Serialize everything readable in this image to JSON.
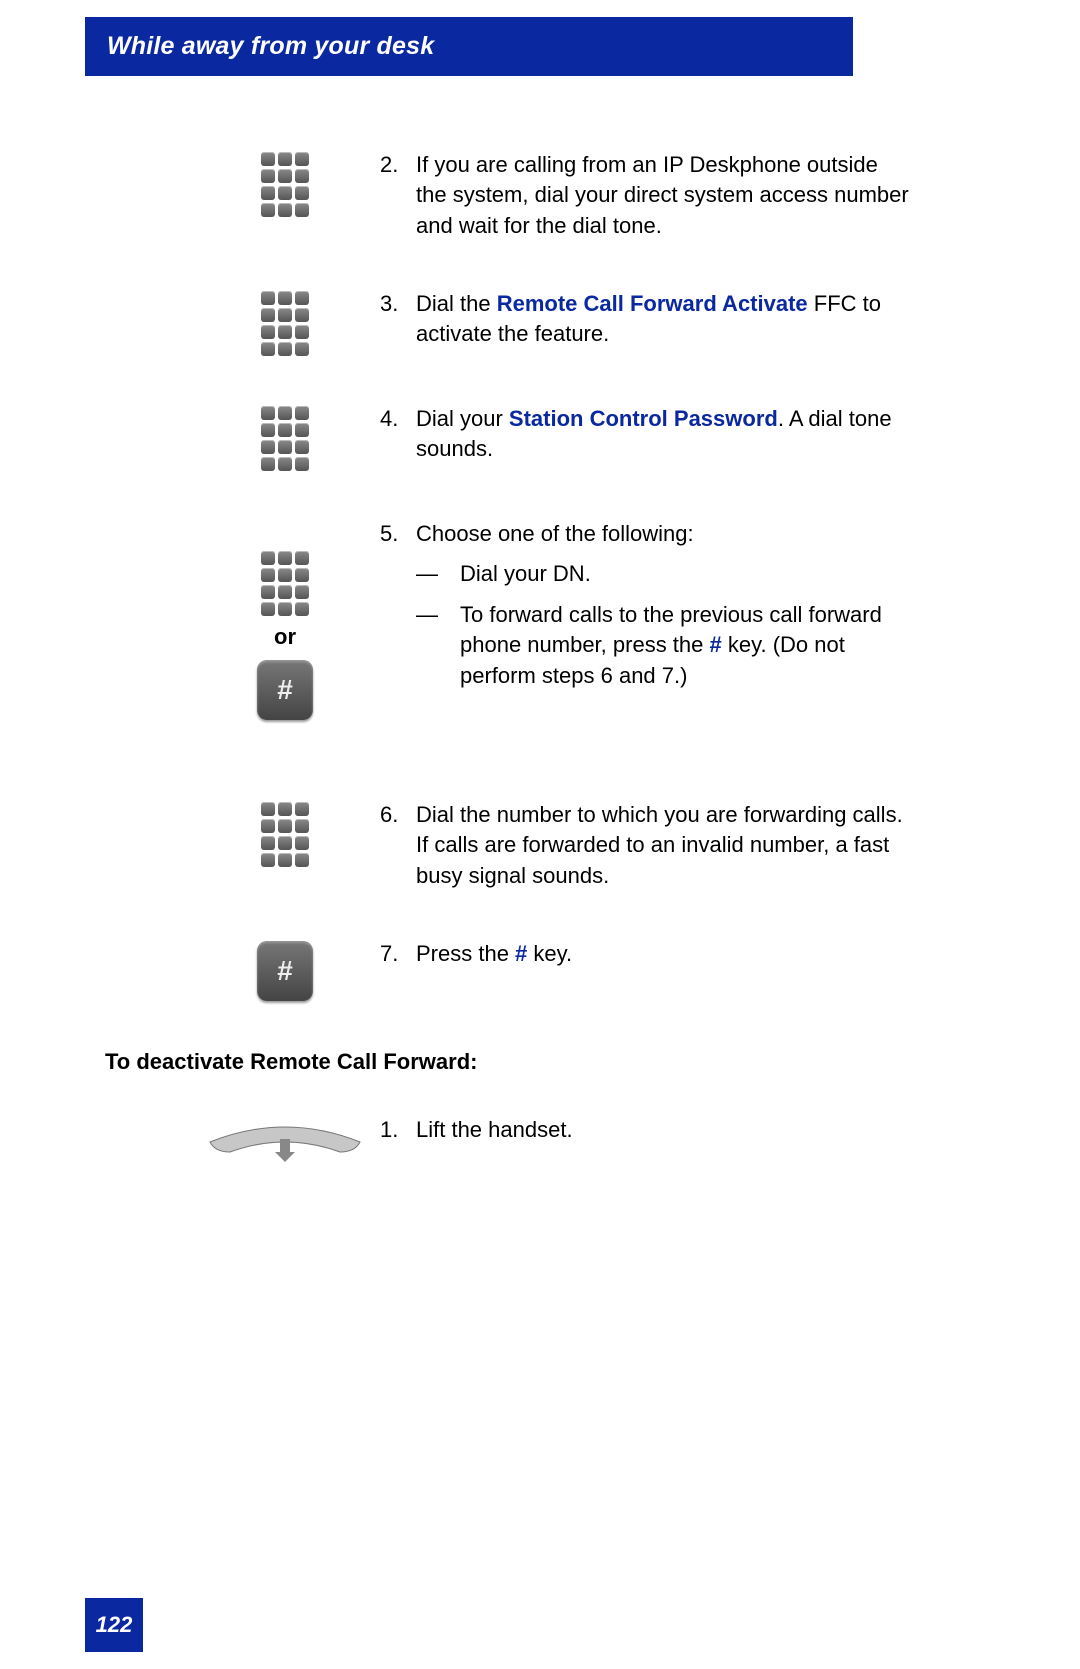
{
  "header": {
    "title": "While away from your desk"
  },
  "steps": {
    "s2": {
      "num": "2.",
      "text": "If you are calling from an IP Deskphone outside the system, dial your direct system access number and wait for the dial tone."
    },
    "s3": {
      "num": "3.",
      "pre": "Dial the ",
      "link": "Remote Call Forward Activate",
      "post": " FFC to activate the feature."
    },
    "s4": {
      "num": "4.",
      "pre": "Dial your ",
      "link": "Station Control Password",
      "post": ". A dial tone sounds."
    },
    "s5": {
      "num": "5.",
      "intro": "Choose one of the following:",
      "dash1": "—",
      "opt1": "Dial your DN.",
      "dash2": "—",
      "opt2_pre": "To forward calls to the previous call forward phone number, press the ",
      "opt2_link": "#",
      "opt2_post": " key. (Do not perform steps 6 and 7.)"
    },
    "or_label": "or",
    "s6": {
      "num": "6.",
      "text": "Dial the number to which you are forwarding calls. If calls are forwarded to an invalid number, a fast busy signal sounds."
    },
    "s7": {
      "num": "7.",
      "pre": "Press the ",
      "link": "#",
      "post": " key."
    }
  },
  "deactivate_heading": "To deactivate Remote Call Forward:",
  "deactivate_step1": {
    "num": "1.",
    "text": "Lift the handset."
  },
  "page_number": "122",
  "glyphs": {
    "hash": "#"
  }
}
